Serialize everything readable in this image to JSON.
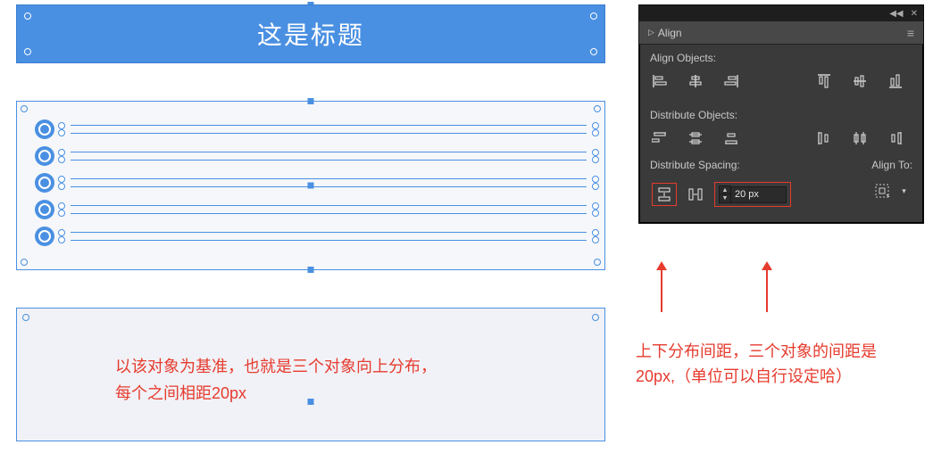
{
  "artboard": {
    "title": "这是标题",
    "note_line1": "以该对象为基准，也就是三个对象向上分布，",
    "note_line2": "每个之间相距20px"
  },
  "panel": {
    "tab_label": "Align",
    "sections": {
      "align_objects": "Align Objects:",
      "distribute_objects": "Distribute Objects:",
      "distribute_spacing": "Distribute Spacing:",
      "align_to": "Align To:"
    },
    "spacing_value": "20 px"
  },
  "annotation": {
    "line1": "上下分布间距，三个对象的间距是",
    "line2": "20px,（单位可以自行设定哈）"
  },
  "icons": {
    "collapse": "◀◀",
    "close": "✕",
    "menu": "≡",
    "tri": "▷"
  }
}
